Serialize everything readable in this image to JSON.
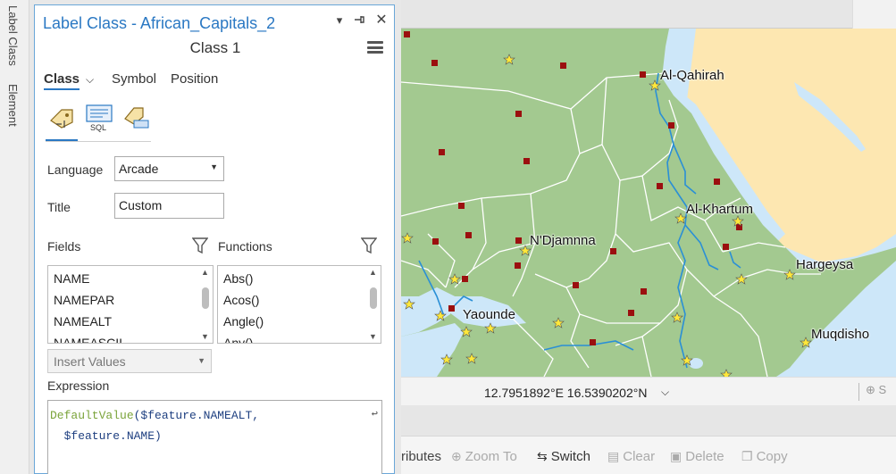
{
  "side_tabs": [
    "Label Class",
    "Element"
  ],
  "pane": {
    "title": "Label Class - African_Capitals_2",
    "class_name": "Class 1",
    "tabs": {
      "class": "Class",
      "symbol": "Symbol",
      "position": "Position"
    },
    "language_label": "Language",
    "language_value": "Arcade",
    "title_label": "Title",
    "title_value": "Custom",
    "fields_label": "Fields",
    "functions_label": "Functions",
    "fields": [
      "NAME",
      "NAMEPAR",
      "NAMEALT",
      "NAMEASCII"
    ],
    "functions": [
      "Abs()",
      "Acos()",
      "Angle()",
      "Any()"
    ],
    "insert_values": "Insert Values",
    "expression_label": "Expression",
    "expression": {
      "fn": "DefaultValue",
      "line1_rest": "($feature.NAMEALT,",
      "line2": "  $feature.NAME)"
    }
  },
  "map": {
    "labels": {
      "cairo": "Al-Qahirah",
      "khartum": "Al-Khartum",
      "ndjamena": "N'Djamnna",
      "hargeysa": "Hargeysa",
      "yaounde": "Yaounde",
      "muqdisho": "Muqdisho"
    },
    "colors": {
      "land": "#a3c990",
      "water": "#cde7f9",
      "desert": "#fde7b1",
      "borders": "#ffffff",
      "rivers": "#2a8fd6",
      "capital_star": "#ffe83a",
      "city_square": "#9b0f0f"
    }
  },
  "status": {
    "coords": "12.7951892°E 16.5390202°N"
  },
  "attribute_toolbar": {
    "attributes": "ributes",
    "zoom_to": "Zoom To",
    "switch": "Switch",
    "clear": "Clear",
    "delete": "Delete",
    "copy": "Copy"
  }
}
